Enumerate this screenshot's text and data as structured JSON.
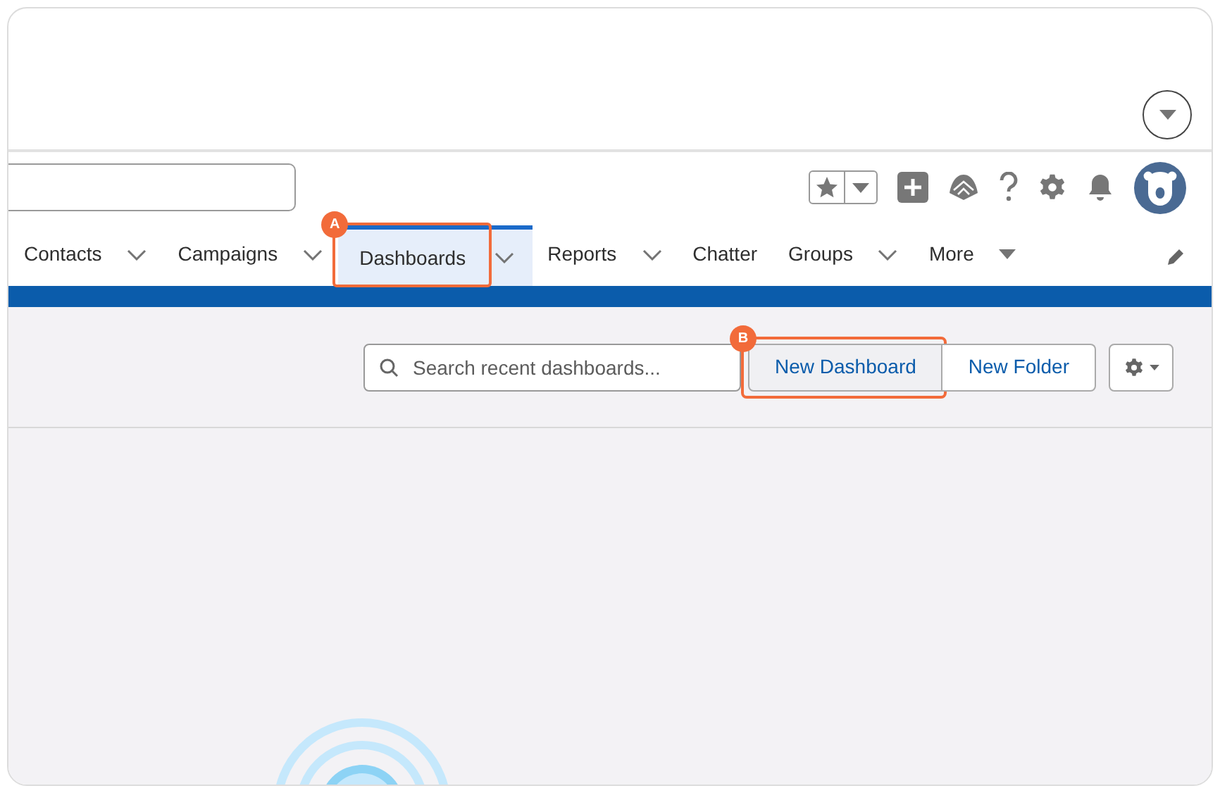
{
  "nav": {
    "tabs": [
      {
        "label": "Contacts",
        "selected": false,
        "kind": "chevron"
      },
      {
        "label": "Campaigns",
        "selected": false,
        "kind": "chevron"
      },
      {
        "label": "Dashboards",
        "selected": true,
        "kind": "chevron",
        "annotation": "A"
      },
      {
        "label": "Reports",
        "selected": false,
        "kind": "chevron"
      },
      {
        "label": "Chatter",
        "selected": false,
        "kind": "plain"
      },
      {
        "label": "Groups",
        "selected": false,
        "kind": "chevron"
      },
      {
        "label": "More",
        "selected": false,
        "kind": "caret"
      }
    ]
  },
  "toolbar": {
    "search": {
      "placeholder": "Search recent dashboards..."
    },
    "buttons": [
      {
        "label": "New Dashboard",
        "annotation": "B"
      },
      {
        "label": "New Folder"
      }
    ]
  }
}
